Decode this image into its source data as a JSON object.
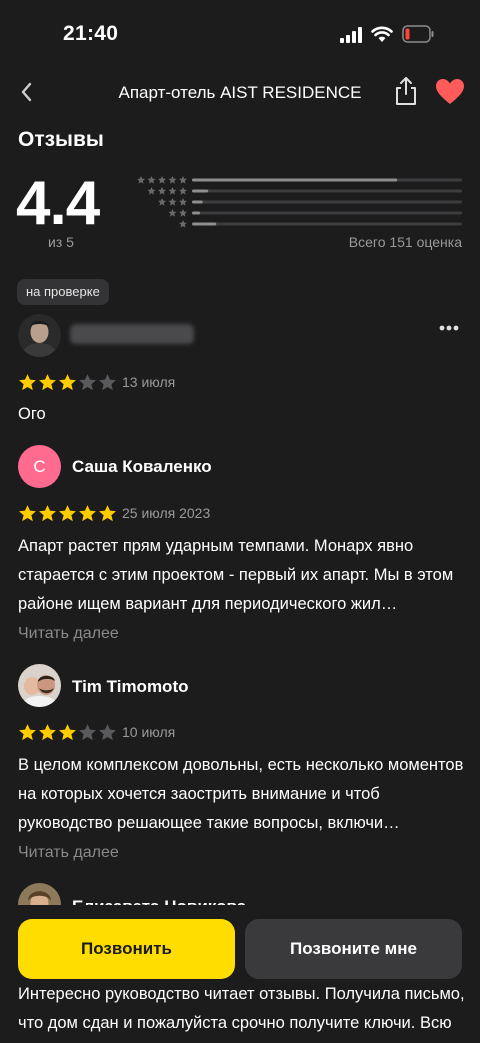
{
  "status": {
    "time": "21:40"
  },
  "nav": {
    "title": "Апарт-отель AIST RESIDENCE"
  },
  "ratings": {
    "section_title": "Отзывы",
    "score": "4.4",
    "out_of": "из 5",
    "total": "Всего 151 оценка",
    "distribution": [
      {
        "stars": 5,
        "fraction": 0.76
      },
      {
        "stars": 4,
        "fraction": 0.06
      },
      {
        "stars": 3,
        "fraction": 0.04
      },
      {
        "stars": 2,
        "fraction": 0.03
      },
      {
        "stars": 1,
        "fraction": 0.09
      }
    ]
  },
  "badge": "на проверке",
  "reviews": [
    {
      "author": "",
      "rating": 3,
      "date": "13 июля",
      "text": "Ого",
      "read_more": ""
    },
    {
      "author": "Саша Коваленко",
      "avatar_letter": "С",
      "rating": 5,
      "date": "25 июля 2023",
      "text": "Апарт растет прям ударным темпами. Монарх явно старается с этим проектом - первый их апарт. Мы в этом районе ищем вариант для периодического жил…",
      "read_more": "Читать далее"
    },
    {
      "author": "Tim Timomoto",
      "rating": 3,
      "date": "10 июля",
      "text": "В целом комплексом довольны, есть несколько моментов на которых хочется заострить внимание и чтоб руководство решающее такие вопросы, включи…",
      "read_more": "Читать далее"
    },
    {
      "author": "Елизавета Новикова",
      "rating": 0,
      "date": "",
      "text": "Интересно руководство читает отзывы. Получила письмо, что дом сдан и пожалуйста срочно получите ключи. Всю неделю звоню, никто не отвечает. Сегод…",
      "read_more": ""
    }
  ],
  "actions": {
    "call": "Позвонить",
    "call_me": "Позвоните мне"
  },
  "colors": {
    "accent": "#ffdd00",
    "star": "#ffcc00",
    "heart": "#ff5b5b",
    "avatar_pink": "#ff6b8e"
  }
}
